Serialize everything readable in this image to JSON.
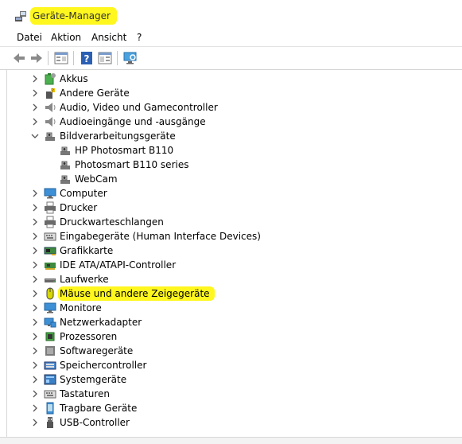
{
  "window": {
    "title": "Geräte-Manager"
  },
  "menu": {
    "items": [
      "Datei",
      "Aktion",
      "Ansicht",
      "?"
    ]
  },
  "tree": {
    "categories": [
      {
        "label": "Akkus",
        "icon": "battery-icon"
      },
      {
        "label": "Andere Geräte",
        "icon": "unknown-device-icon"
      },
      {
        "label": "Audio, Video und Gamecontroller",
        "icon": "speaker-icon"
      },
      {
        "label": "Audioeingänge und -ausgänge",
        "icon": "speaker-icon"
      },
      {
        "label": "Bildverarbeitungsgeräte",
        "icon": "camera-icon",
        "expanded": true,
        "children": [
          "HP Photosmart B110",
          "Photosmart B110 series",
          "WebCam"
        ]
      },
      {
        "label": "Computer",
        "icon": "monitor-icon"
      },
      {
        "label": "Drucker",
        "icon": "printer-icon"
      },
      {
        "label": "Druckwarteschlangen",
        "icon": "printer-icon"
      },
      {
        "label": "Eingabegeräte (Human Interface Devices)",
        "icon": "keyboard-icon"
      },
      {
        "label": "Grafikkarte",
        "icon": "graphics-card-icon"
      },
      {
        "label": "IDE ATA/ATAPI-Controller",
        "icon": "controller-icon"
      },
      {
        "label": "Laufwerke",
        "icon": "drive-icon"
      },
      {
        "label": "Mäuse und andere Zeigegeräte",
        "icon": "mouse-icon",
        "highlighted": true
      },
      {
        "label": "Monitore",
        "icon": "monitor-icon"
      },
      {
        "label": "Netzwerkadapter",
        "icon": "network-icon"
      },
      {
        "label": "Prozessoren",
        "icon": "processor-icon"
      },
      {
        "label": "Softwaregeräte",
        "icon": "software-device-icon"
      },
      {
        "label": "Speichercontroller",
        "icon": "storage-controller-icon"
      },
      {
        "label": "Systemgeräte",
        "icon": "system-device-icon"
      },
      {
        "label": "Tastaturen",
        "icon": "keyboard-icon"
      },
      {
        "label": "Tragbare Geräte",
        "icon": "portable-device-icon"
      },
      {
        "label": "USB-Controller",
        "icon": "usb-icon"
      }
    ]
  },
  "colors": {
    "highlight": "#fff71e",
    "accent": "#1e73c8"
  }
}
